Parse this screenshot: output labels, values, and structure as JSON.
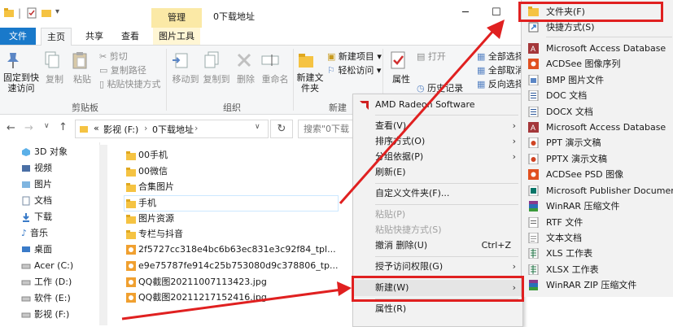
{
  "window": {
    "manage_tab": "管理",
    "title": "0下载地址",
    "minimize": "─",
    "maximize": "☐"
  },
  "ribbon_tabs": {
    "file": "文件",
    "home": "主页",
    "share": "共享",
    "view": "查看",
    "picture_tools": "图片工具"
  },
  "ribbon": {
    "pin_label": "固定到快速访问",
    "copy_label": "复制",
    "paste_label": "粘贴",
    "cut_label": "剪切",
    "copy_path_label": "复制路径",
    "paste_shortcut_label": "粘贴快捷方式",
    "clipboard_group": "剪贴板",
    "move_to_label": "移动到",
    "copy_to_label": "复制到",
    "delete_label": "删除",
    "rename_label": "重命名",
    "organize_group": "组织",
    "new_folder_label": "新建文件夹",
    "new_item_label": "新建项目",
    "easy_access_label": "轻松访问",
    "new_group": "新建",
    "properties_label": "属性",
    "open_label": "打开",
    "history_label": "历史记录",
    "select_all_label": "全部选择",
    "select_none_label": "全部取消",
    "invert_label": "反向选择"
  },
  "address": {
    "path_root": "«",
    "path_1": "影视 (F:)",
    "path_2": "0下载地址",
    "search_placeholder": "搜索\"0下载"
  },
  "nav_items": [
    {
      "label": "3D 对象"
    },
    {
      "label": "视频"
    },
    {
      "label": "图片"
    },
    {
      "label": "文档"
    },
    {
      "label": "下载"
    },
    {
      "label": "音乐"
    },
    {
      "label": "桌面"
    },
    {
      "label": "Acer (C:)"
    },
    {
      "label": "工作 (D:)"
    },
    {
      "label": "软件 (E:)"
    },
    {
      "label": "影视 (F:)"
    }
  ],
  "files": [
    {
      "name": "00手机"
    },
    {
      "name": "00微信"
    },
    {
      "name": "合集图片"
    },
    {
      "name": "手机"
    },
    {
      "name": "图片资源"
    },
    {
      "name": "专栏与抖音"
    },
    {
      "name": "2f5727cc318e4bc6b63ec831e3c92f84_tpl..."
    },
    {
      "name": "e9e75787fe914c25b753080d9c378806_tp..."
    },
    {
      "name": "QQ截图20211007113423.jpg"
    },
    {
      "name": "QQ截图20211217152416.jpg"
    }
  ],
  "context_menu": {
    "amd": "AMD Radeon Software",
    "view": "查看(V)",
    "sort": "排序方式(O)",
    "group": "分组依据(P)",
    "refresh": "刷新(E)",
    "customize": "自定义文件夹(F)...",
    "paste": "粘贴(P)",
    "paste_shortcut": "粘贴快捷方式(S)",
    "undo_delete": "撤消 删除(U)",
    "undo_shortcut": "Ctrl+Z",
    "grant_access": "授予访问权限(G)",
    "new": "新建(W)",
    "properties": "属性(R)"
  },
  "submenu": [
    {
      "label": "文件夹(F)",
      "icon": "folder-icon"
    },
    {
      "label": "快捷方式(S)",
      "icon": "shortcut-icon"
    },
    {
      "label": "Microsoft Access Database",
      "icon": "access-icon"
    },
    {
      "label": "ACDSee 图像序列",
      "icon": "acdsee-icon"
    },
    {
      "label": "BMP 图片文件",
      "icon": "bmp-icon"
    },
    {
      "label": "DOC 文档",
      "icon": "doc-icon"
    },
    {
      "label": "DOCX 文档",
      "icon": "docx-icon"
    },
    {
      "label": "Microsoft Access Database",
      "icon": "access-icon"
    },
    {
      "label": "PPT 演示文稿",
      "icon": "ppt-icon"
    },
    {
      "label": "PPTX 演示文稿",
      "icon": "pptx-icon"
    },
    {
      "label": "ACDSee PSD 图像",
      "icon": "psd-icon"
    },
    {
      "label": "Microsoft Publisher Document",
      "icon": "publisher-icon"
    },
    {
      "label": "WinRAR 压缩文件",
      "icon": "winrar-icon"
    },
    {
      "label": "RTF 文件",
      "icon": "rtf-icon"
    },
    {
      "label": "文本文档",
      "icon": "txt-icon"
    },
    {
      "label": "XLS 工作表",
      "icon": "xls-icon"
    },
    {
      "label": "XLSX 工作表",
      "icon": "xlsx-icon"
    },
    {
      "label": "WinRAR ZIP 压缩文件",
      "icon": "winrar-zip-icon"
    }
  ],
  "colors": {
    "file_tab": "#1979ca",
    "highlight_red": "#e02020",
    "folder_yellow": "#f5c342",
    "manage_tab": "#fbe9a6"
  }
}
